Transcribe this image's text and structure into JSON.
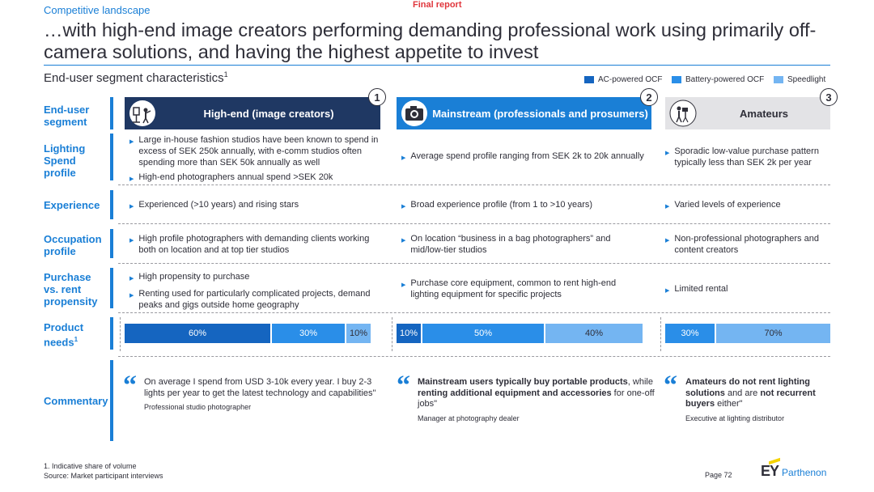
{
  "header": {
    "section": "Competitive landscape",
    "status": "Final report",
    "title": "…with high-end image creators performing demanding professional work using primarily off-camera solutions, and having the highest appetite to invest"
  },
  "subtitle": {
    "text": "End-user segment characteristics",
    "footnote_ref": "1"
  },
  "legend": [
    {
      "label": "AC-powered OCF",
      "color": "#1565c0"
    },
    {
      "label": "Battery-powered OCF",
      "color": "#2a8ee8"
    },
    {
      "label": "Speedlight",
      "color": "#74b5f2"
    }
  ],
  "rows": {
    "segment": "End-user segment",
    "lighting_spend": "Lighting Spend profile",
    "experience": "Experience",
    "occupation": "Occupation profile",
    "purchase": "Purchase vs. rent propensity",
    "product_needs": "Product needs",
    "product_needs_ref": "1",
    "commentary": "Commentary"
  },
  "segments": [
    {
      "number": "1",
      "name": "High-end (image creators)",
      "icon": "studio-lights-icon",
      "lighting_spend": [
        "Large in-house fashion studios have been known to spend in excess of SEK 250k annually, with e-comm studios often spending more than SEK 50k annually as well",
        "High-end photographers annual spend >SEK 20k"
      ],
      "experience": [
        "Experienced (>10 years) and rising stars"
      ],
      "occupation": [
        "High profile photographers with demanding clients working both on location and at top tier studios"
      ],
      "purchase": [
        "High propensity to purchase",
        "Renting used for particularly complicated projects, demand peaks and gigs outside home geography"
      ],
      "needs": [
        {
          "label": "60%",
          "value": 60,
          "type": "ac"
        },
        {
          "label": "30%",
          "value": 30,
          "type": "battery"
        },
        {
          "label": "10%",
          "value": 10,
          "type": "speedlight"
        }
      ],
      "comment_plain": "On average I spend from USD 3-10k every year. I buy 2-3 lights per year to get the latest technology and capabilities\"",
      "attribution": "Professional studio photographer"
    },
    {
      "number": "2",
      "name": "Mainstream (professionals and prosumers)",
      "icon": "camera-icon",
      "lighting_spend": [
        "Average spend profile ranging from SEK 2k to 20k annually"
      ],
      "experience": [
        "Broad experience profile (from 1 to >10 years)"
      ],
      "occupation": [
        "On location “business in a bag photographers” and mid/low-tier studios"
      ],
      "purchase": [
        "Purchase core equipment, common to rent high-end lighting equipment for specific projects"
      ],
      "needs": [
        {
          "label": "10%",
          "value": 10,
          "type": "ac"
        },
        {
          "label": "50%",
          "value": 50,
          "type": "battery"
        },
        {
          "label": "40%",
          "value": 40,
          "type": "speedlight"
        }
      ],
      "comment_b1": "Mainstream users typically buy portable products",
      "comment_t1": ", while ",
      "comment_b2": "renting additional equipment and accessories",
      "comment_t2": " for one-off jobs\"",
      "attribution": "Manager at photography dealer"
    },
    {
      "number": "3",
      "name": "Amateurs",
      "icon": "photographer-tripod-icon",
      "lighting_spend": [
        "Sporadic low-value purchase pattern typically less than SEK 2k per year"
      ],
      "experience": [
        "Varied levels of experience"
      ],
      "occupation": [
        "Non-professional photographers and content creators"
      ],
      "purchase": [
        "Limited rental"
      ],
      "needs": [
        {
          "label": "30%",
          "value": 30,
          "type": "battery"
        },
        {
          "label": "70%",
          "value": 70,
          "type": "speedlight"
        }
      ],
      "comment_b1": "Amateurs do not rent lighting solutions",
      "comment_t1": " and are ",
      "comment_b2": "not recurrent buyers",
      "comment_t2": " either\"",
      "attribution": "Executive at lighting distributor"
    }
  ],
  "footer": {
    "footnote": "1. Indicative share of volume",
    "source": "Source: Market participant interviews",
    "page": "Page 72",
    "logo_ey": "EY",
    "logo_brand": "Parthenon"
  }
}
